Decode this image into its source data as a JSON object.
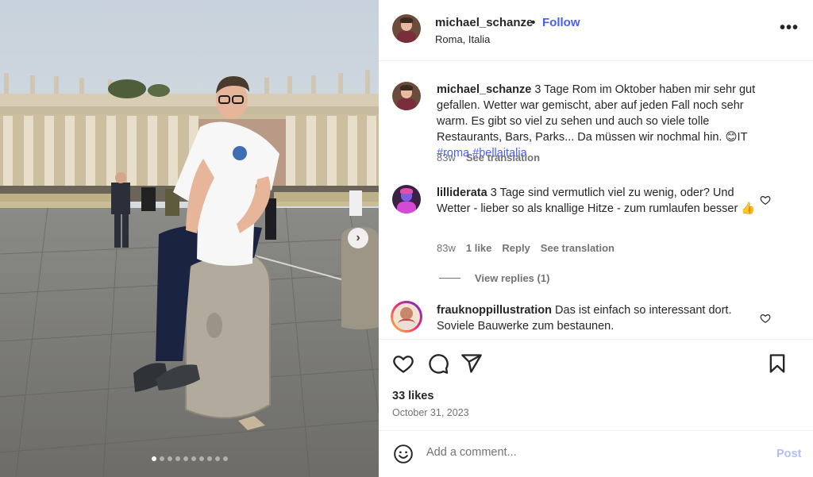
{
  "header": {
    "username": "michael_schanze",
    "separator": "•",
    "follow_label": "Follow",
    "location": "Roma, Italia",
    "more_icon": "ellipsis-icon"
  },
  "caption": {
    "username": "michael_schanze",
    "text": "3 Tage Rom im Oktober haben mir sehr gut gefallen. Wetter war gemischt, aber auf jeden Fall noch sehr warm. Es gibt so viel zu sehen und auch so viele tolle Restaurants, Bars, Parks... Da müssen wir nochmal hin. 😊IT",
    "hashtags": "#roma #bellaitalia",
    "age": "83w",
    "see_translation": "See translation"
  },
  "comments": [
    {
      "username": "lilliderata",
      "text": "3 Tage sind vermutlich viel zu wenig, oder? Und Wetter - lieber so als knallige Hitze - zum rumlaufen besser 👍",
      "age": "83w",
      "likes": "1 like",
      "reply": "Reply",
      "see_translation": "See translation",
      "view_replies": "View replies (1)"
    },
    {
      "username": "frauknoppillustration",
      "text": "Das ist einfach so interessant dort. Soviele Bauwerke zum bestaunen."
    }
  ],
  "actions": {
    "icons": [
      "heart-icon",
      "comment-icon",
      "share-icon",
      "bookmark-icon"
    ],
    "likes": "33 likes",
    "date": "October 31, 2023"
  },
  "add_comment": {
    "placeholder": "Add a comment...",
    "post_label": "Post",
    "emoji_icon": "emoji-icon"
  },
  "carousel": {
    "slide_count": 10,
    "active_index": 0
  },
  "colors": {
    "link_blue": "#4a5df9",
    "post_disabled": "#b2bdfb",
    "muted": "#737373"
  }
}
